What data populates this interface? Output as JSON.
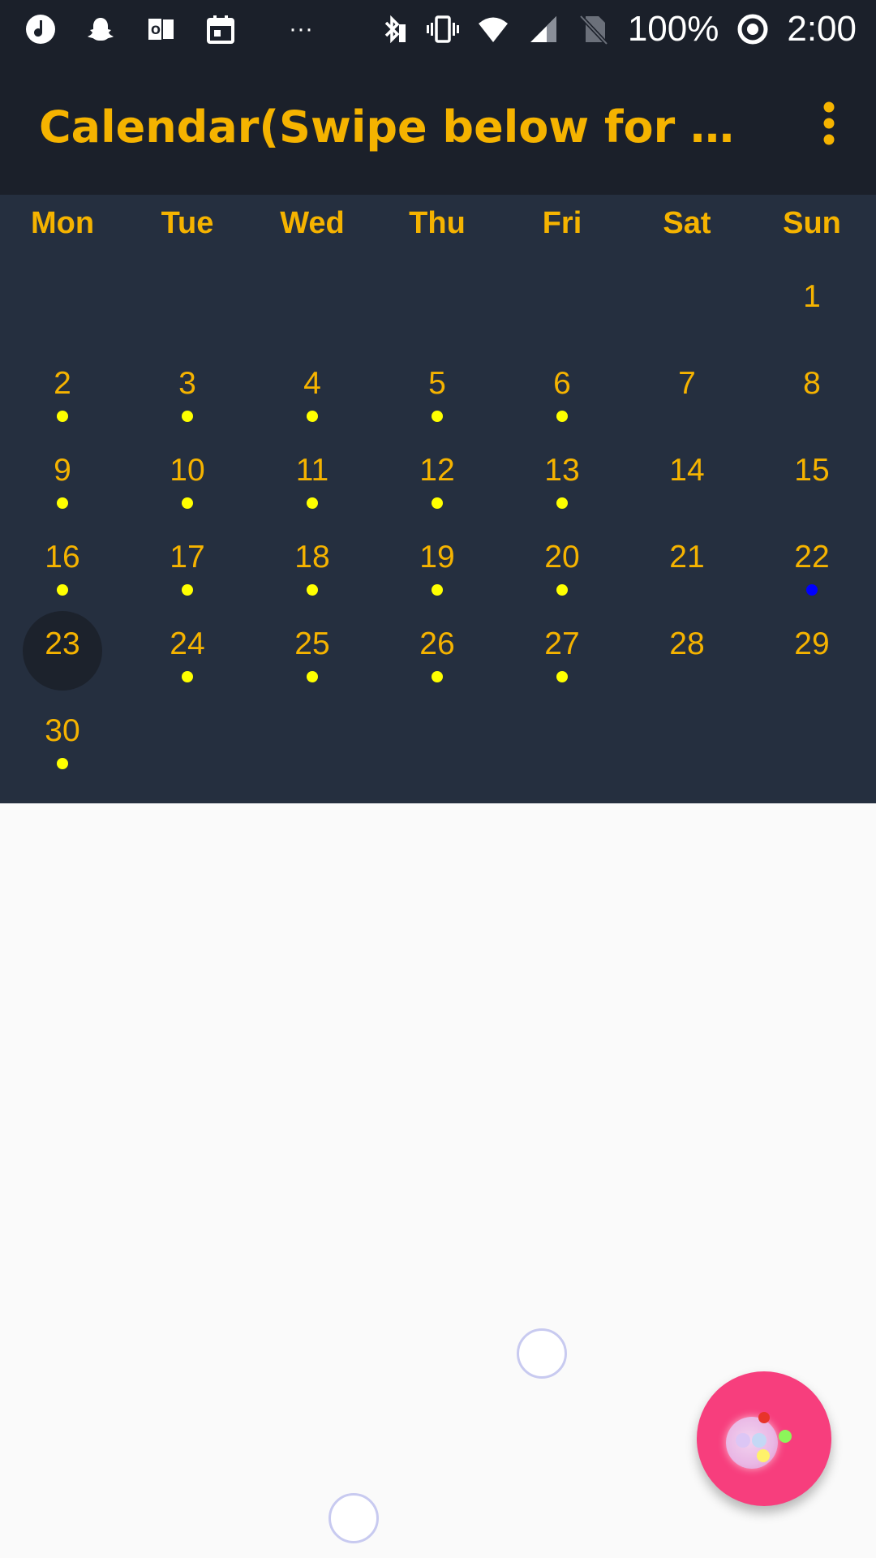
{
  "status_bar": {
    "battery": "100%",
    "time": "2:00",
    "more_icon_text": "···"
  },
  "app_bar": {
    "title": "Calendar(Swipe below for m…"
  },
  "calendar": {
    "weekdays": [
      "Mon",
      "Tue",
      "Wed",
      "Thu",
      "Fri",
      "Sat",
      "Sun"
    ],
    "selected_day": "23",
    "event_colors": {
      "yellow": "#ffff00",
      "blue": "#0000ff"
    },
    "days": [
      {
        "label": "1",
        "dot": ""
      },
      {
        "label": "2",
        "dot": "yellow"
      },
      {
        "label": "3",
        "dot": "yellow"
      },
      {
        "label": "4",
        "dot": "yellow"
      },
      {
        "label": "5",
        "dot": "yellow"
      },
      {
        "label": "6",
        "dot": "yellow"
      },
      {
        "label": "7",
        "dot": ""
      },
      {
        "label": "8",
        "dot": ""
      },
      {
        "label": "9",
        "dot": "yellow"
      },
      {
        "label": "10",
        "dot": "yellow"
      },
      {
        "label": "11",
        "dot": "yellow"
      },
      {
        "label": "12",
        "dot": "yellow"
      },
      {
        "label": "13",
        "dot": "yellow"
      },
      {
        "label": "14",
        "dot": ""
      },
      {
        "label": "15",
        "dot": ""
      },
      {
        "label": "16",
        "dot": "yellow"
      },
      {
        "label": "17",
        "dot": "yellow"
      },
      {
        "label": "18",
        "dot": "yellow"
      },
      {
        "label": "19",
        "dot": "yellow"
      },
      {
        "label": "20",
        "dot": "yellow"
      },
      {
        "label": "21",
        "dot": ""
      },
      {
        "label": "22",
        "dot": "blue"
      },
      {
        "label": "23",
        "dot": ""
      },
      {
        "label": "24",
        "dot": "yellow"
      },
      {
        "label": "25",
        "dot": "yellow"
      },
      {
        "label": "26",
        "dot": "yellow"
      },
      {
        "label": "27",
        "dot": "yellow"
      },
      {
        "label": "28",
        "dot": ""
      },
      {
        "label": "29",
        "dot": ""
      },
      {
        "label": "30",
        "dot": "yellow"
      }
    ]
  },
  "colors": {
    "header_bg": "#1b202a",
    "calendar_bg": "#252f3f",
    "accent": "#f5b300",
    "fab": "#f73e7d"
  }
}
